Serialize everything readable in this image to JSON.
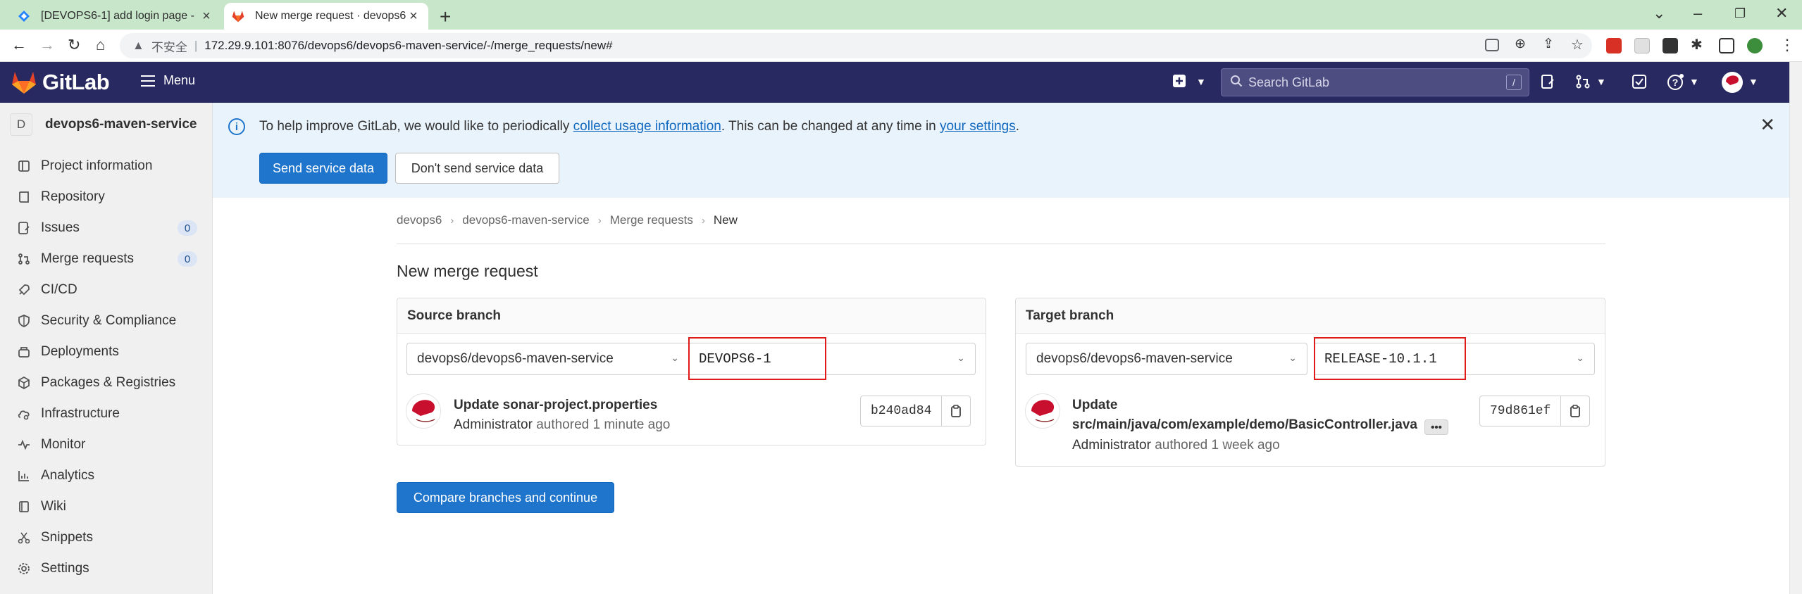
{
  "browser": {
    "tabs": [
      {
        "title": "[DEVOPS6-1] add login page -",
        "active": false
      },
      {
        "title": "New merge request · devops6",
        "active": true
      }
    ],
    "insecure_label": "不安全",
    "url": "172.29.9.101:8076/devops6/devops6-maven-service/-/merge_requests/new#"
  },
  "header": {
    "brand": "GitLab",
    "menu_label": "Menu",
    "search_placeholder": "Search GitLab",
    "search_shortcut": "/"
  },
  "sidebar": {
    "project_letter": "D",
    "project_name": "devops6-maven-service",
    "items": [
      {
        "label": "Project information",
        "icon": "project-icon"
      },
      {
        "label": "Repository",
        "icon": "repository-icon"
      },
      {
        "label": "Issues",
        "icon": "issues-icon",
        "count": "0"
      },
      {
        "label": "Merge requests",
        "icon": "merge-request-icon",
        "count": "0"
      },
      {
        "label": "CI/CD",
        "icon": "rocket-icon"
      },
      {
        "label": "Security & Compliance",
        "icon": "shield-icon"
      },
      {
        "label": "Deployments",
        "icon": "deployments-icon"
      },
      {
        "label": "Packages & Registries",
        "icon": "package-icon"
      },
      {
        "label": "Infrastructure",
        "icon": "cloud-gear-icon"
      },
      {
        "label": "Monitor",
        "icon": "monitor-icon"
      },
      {
        "label": "Analytics",
        "icon": "chart-icon"
      },
      {
        "label": "Wiki",
        "icon": "book-icon"
      },
      {
        "label": "Snippets",
        "icon": "scissors-icon"
      },
      {
        "label": "Settings",
        "icon": "gear-icon"
      }
    ]
  },
  "alert": {
    "text_before": "To help improve GitLab, we would like to periodically ",
    "link1": "collect usage information",
    "text_middle": ". This can be changed at any time in ",
    "link2": "your settings",
    "text_after": ".",
    "primary_button": "Send service data",
    "secondary_button": "Don't send service data"
  },
  "breadcrumbs": [
    "devops6",
    "devops6-maven-service",
    "Merge requests",
    "New"
  ],
  "page_title": "New merge request",
  "source": {
    "heading": "Source branch",
    "project": "devops6/devops6-maven-service",
    "branch": "DEVOPS6-1",
    "commit_title": "Update sonar-project.properties",
    "author": "Administrator",
    "authored": "authored 1 minute ago",
    "sha": "b240ad84"
  },
  "target": {
    "heading": "Target branch",
    "project": "devops6/devops6-maven-service",
    "branch": "RELEASE-10.1.1",
    "commit_title_line1": "Update",
    "commit_title_line2": "src/main/java/com/example/demo/BasicController.java",
    "author": "Administrator",
    "authored": "authored 1 week ago",
    "sha": "79d861ef"
  },
  "compare_button": "Compare branches and continue",
  "colors": {
    "header_bg": "#292961",
    "primary": "#1f75cb",
    "alert_bg": "#e9f3fc",
    "highlight_box": "#e01919"
  }
}
